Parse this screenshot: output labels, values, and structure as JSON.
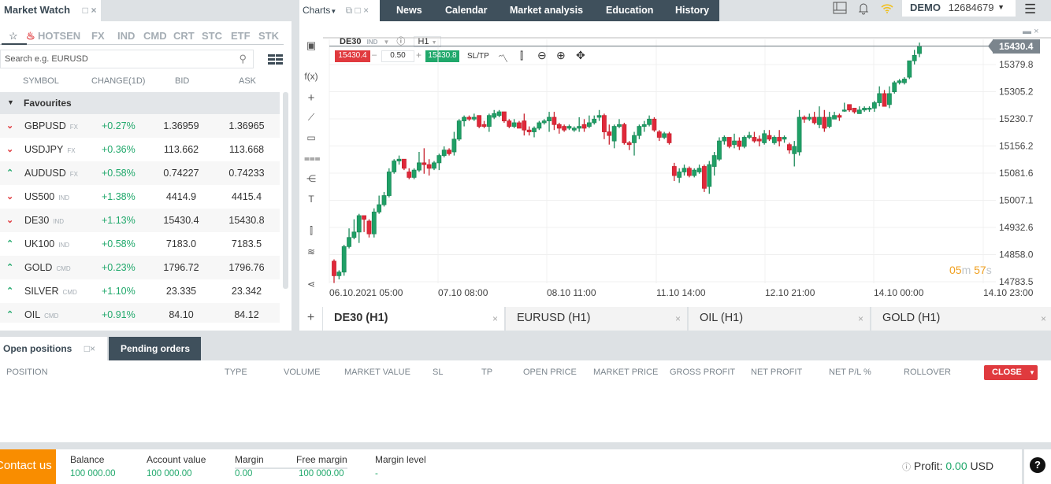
{
  "market_watch": {
    "title": "Market Watch",
    "categories": [
      "HOTSEN",
      "FX",
      "IND",
      "CMD",
      "CRT",
      "STC",
      "ETF",
      "STK"
    ],
    "search_placeholder": "Search e.g. EURUSD",
    "columns": [
      "SYMBOL",
      "CHANGE(1D)",
      "BID",
      "ASK"
    ],
    "group": "Favourites",
    "rows": [
      {
        "dir": "down",
        "symbol": "GBPUSD",
        "type": "FX",
        "change": "+0.27%",
        "bid": "1.36959",
        "ask": "1.36965"
      },
      {
        "dir": "down",
        "symbol": "USDJPY",
        "type": "FX",
        "change": "+0.36%",
        "bid": "113.662",
        "ask": "113.668"
      },
      {
        "dir": "up",
        "symbol": "AUDUSD",
        "type": "FX",
        "change": "+0.58%",
        "bid": "0.74227",
        "ask": "0.74233"
      },
      {
        "dir": "down",
        "symbol": "US500",
        "type": "IND",
        "change": "+1.38%",
        "bid": "4414.9",
        "ask": "4415.4"
      },
      {
        "dir": "down",
        "symbol": "DE30",
        "type": "IND",
        "change": "+1.13%",
        "bid": "15430.4",
        "ask": "15430.8"
      },
      {
        "dir": "up",
        "symbol": "UK100",
        "type": "IND",
        "change": "+0.58%",
        "bid": "7183.0",
        "ask": "7183.5"
      },
      {
        "dir": "up",
        "symbol": "GOLD",
        "type": "CMD",
        "change": "+0.23%",
        "bid": "1796.72",
        "ask": "1796.76"
      },
      {
        "dir": "up",
        "symbol": "SILVER",
        "type": "CMD",
        "change": "+1.10%",
        "bid": "23.335",
        "ask": "23.342"
      },
      {
        "dir": "up",
        "symbol": "OIL",
        "type": "CMD",
        "change": "+0.91%",
        "bid": "84.10",
        "ask": "84.12"
      }
    ]
  },
  "top_nav": {
    "charts_label": "Charts",
    "items": [
      "News",
      "Calendar",
      "Market analysis",
      "Education",
      "History"
    ],
    "account_mode": "DEMO",
    "account_number": "12684679"
  },
  "chart": {
    "symbol": "DE30",
    "symbol_type": "IND",
    "timeframe": "H1",
    "sell_price": "15430.4",
    "volume": "0.50",
    "buy_price": "15430.8",
    "sltp_label": "SL/TP",
    "current_price": "15430.4",
    "timer_min": "05",
    "timer_sec": "57",
    "tabs": [
      {
        "label": "DE30 (H1)",
        "active": true
      },
      {
        "label": "EURUSD (H1)",
        "active": false
      },
      {
        "label": "OIL (H1)",
        "active": false
      },
      {
        "label": "GOLD (H1)",
        "active": false
      }
    ]
  },
  "chart_data": {
    "type": "candlestick",
    "title": "DE30 H1",
    "xlabel": "",
    "ylabel": "",
    "y_ticks": [
      "15379.8",
      "15305.2",
      "15230.7",
      "15156.2",
      "15081.6",
      "15007.1",
      "14932.6",
      "14858.0",
      "14783.5"
    ],
    "ylim": [
      14770,
      15440
    ],
    "x_ticks": [
      "06.10.2021 05:00",
      "07.10 08:00",
      "08.10 11:00",
      "11.10 14:00",
      "12.10 21:00",
      "14.10 00:00",
      "14.10 23:00"
    ],
    "last_price": 15430.4,
    "candles": [
      [
        14840,
        14800,
        14845,
        14780
      ],
      [
        14800,
        14810,
        14815,
        14790
      ],
      [
        14810,
        14880,
        14885,
        14800
      ],
      [
        14880,
        14905,
        14930,
        14875
      ],
      [
        14905,
        14920,
        14955,
        14900
      ],
      [
        14920,
        14965,
        14970,
        14890
      ],
      [
        14965,
        14955,
        14965,
        14920
      ],
      [
        14950,
        14915,
        14955,
        14905
      ],
      [
        14915,
        14975,
        14985,
        14905
      ],
      [
        14975,
        14995,
        15020,
        14970
      ],
      [
        14995,
        15020,
        15030,
        14990
      ],
      [
        15020,
        15085,
        15095,
        15015
      ],
      [
        15085,
        15115,
        15120,
        15080
      ],
      [
        15115,
        15120,
        15130,
        15105
      ],
      [
        15120,
        15095,
        15120,
        15090
      ],
      [
        15085,
        15070,
        15095,
        15065
      ],
      [
        15070,
        15090,
        15095,
        15065
      ],
      [
        15090,
        15110,
        15140,
        15085
      ],
      [
        15110,
        15105,
        15150,
        15080
      ],
      [
        15105,
        15095,
        15120,
        15075
      ],
      [
        15095,
        15110,
        15115,
        15090
      ],
      [
        15110,
        15130,
        15135,
        15090
      ],
      [
        15130,
        15145,
        15155,
        15125
      ],
      [
        15145,
        15135,
        15150,
        15130
      ],
      [
        15140,
        15175,
        15195,
        15130
      ],
      [
        15175,
        15225,
        15230,
        15170
      ],
      [
        15225,
        15235,
        15240,
        15210
      ],
      [
        15235,
        15230,
        15240,
        15225
      ],
      [
        15230,
        15235,
        15245,
        15225
      ],
      [
        15240,
        15210,
        15240,
        15205
      ],
      [
        15215,
        15210,
        15225,
        15205
      ],
      [
        15210,
        15240,
        15245,
        15195
      ],
      [
        15235,
        15245,
        15255,
        15230
      ],
      [
        15240,
        15250,
        15255,
        15235
      ],
      [
        15250,
        15225,
        15250,
        15220
      ],
      [
        15225,
        15210,
        15230,
        15205
      ],
      [
        15210,
        15220,
        15230,
        15205
      ],
      [
        15220,
        15205,
        15225,
        15205
      ],
      [
        15225,
        15200,
        15245,
        15185
      ],
      [
        15200,
        15195,
        15210,
        15185
      ],
      [
        15195,
        15205,
        15210,
        15180
      ],
      [
        15205,
        15220,
        15225,
        15200
      ],
      [
        15220,
        15225,
        15230,
        15215
      ],
      [
        15225,
        15235,
        15250,
        15195
      ],
      [
        15235,
        15215,
        15250,
        15200
      ],
      [
        15215,
        15205,
        15220,
        15190
      ],
      [
        15210,
        15200,
        15215,
        15195
      ],
      [
        15205,
        15210,
        15215,
        15200
      ],
      [
        15200,
        15205,
        15210,
        15195
      ],
      [
        15205,
        15210,
        15235,
        15195
      ],
      [
        15215,
        15205,
        15230,
        15195
      ],
      [
        15210,
        15220,
        15240,
        15205
      ],
      [
        15220,
        15230,
        15240,
        15215
      ],
      [
        15235,
        15240,
        15255,
        15225
      ],
      [
        15240,
        15195,
        15245,
        15175
      ],
      [
        15195,
        15185,
        15215,
        15160
      ],
      [
        15170,
        15210,
        15215,
        15150
      ],
      [
        15210,
        15215,
        15230,
        15205
      ],
      [
        15215,
        15165,
        15220,
        15160
      ],
      [
        15165,
        15160,
        15170,
        15145
      ],
      [
        15165,
        15185,
        15195,
        15130
      ],
      [
        15185,
        15210,
        15215,
        15175
      ],
      [
        15210,
        15215,
        15225,
        15195
      ],
      [
        15215,
        15230,
        15240,
        15210
      ],
      [
        15230,
        15200,
        15235,
        15195
      ],
      [
        15195,
        15180,
        15200,
        15170
      ],
      [
        15180,
        15190,
        15195,
        15175
      ],
      [
        15190,
        15165,
        15195,
        15160
      ],
      [
        15100,
        15075,
        15110,
        15060
      ],
      [
        15070,
        15085,
        15095,
        15055
      ],
      [
        15085,
        15095,
        15105,
        15075
      ],
      [
        15095,
        15075,
        15100,
        15070
      ],
      [
        15075,
        15090,
        15095,
        15070
      ],
      [
        15085,
        15095,
        15105,
        15080
      ],
      [
        15100,
        15040,
        15105,
        15030
      ],
      [
        15045,
        15105,
        15115,
        15025
      ],
      [
        15100,
        15130,
        15140,
        15075
      ],
      [
        15120,
        15170,
        15180,
        15115
      ],
      [
        15170,
        15180,
        15185,
        15160
      ],
      [
        15180,
        15155,
        15180,
        15150
      ],
      [
        15160,
        15170,
        15190,
        15150
      ],
      [
        15170,
        15155,
        15180,
        15145
      ],
      [
        15155,
        15180,
        15185,
        15150
      ],
      [
        15180,
        15185,
        15195,
        15175
      ],
      [
        15180,
        15170,
        15195,
        15165
      ],
      [
        15175,
        15170,
        15185,
        15155
      ],
      [
        15165,
        15190,
        15200,
        15160
      ],
      [
        15185,
        15175,
        15200,
        15170
      ],
      [
        15165,
        15180,
        15185,
        15160
      ],
      [
        15180,
        15170,
        15200,
        15155
      ],
      [
        15175,
        15180,
        15185,
        15165
      ],
      [
        15160,
        15145,
        15165,
        15135
      ],
      [
        15135,
        15155,
        15170,
        15100
      ],
      [
        15140,
        15235,
        15255,
        15130
      ],
      [
        15235,
        15230,
        15240,
        15220
      ],
      [
        15230,
        15235,
        15245,
        15225
      ],
      [
        15235,
        15220,
        15250,
        15215
      ],
      [
        15215,
        15235,
        15265,
        15205
      ],
      [
        15235,
        15205,
        15255,
        15195
      ],
      [
        15210,
        15235,
        15250,
        15205
      ],
      [
        15230,
        15240,
        15250,
        15230
      ],
      [
        15240,
        15235,
        15245,
        15225
      ],
      [
        15255,
        15255,
        15275,
        15250
      ],
      [
        15270,
        15255,
        15270,
        15250
      ],
      [
        15260,
        15250,
        15260,
        15245
      ],
      [
        15245,
        15255,
        15265,
        15245
      ],
      [
        15255,
        15260,
        15265,
        15250
      ],
      [
        15260,
        15260,
        15265,
        15250
      ],
      [
        15260,
        15275,
        15280,
        15250
      ],
      [
        15275,
        15300,
        15320,
        15265
      ],
      [
        15300,
        15265,
        15310,
        15265
      ],
      [
        15270,
        15300,
        15320,
        15260
      ],
      [
        15305,
        15330,
        15335,
        15300
      ],
      [
        15330,
        15335,
        15340,
        15325
      ],
      [
        15330,
        15340,
        15345,
        15325
      ],
      [
        15345,
        15390,
        15390,
        15340
      ],
      [
        15390,
        15405,
        15420,
        15380
      ],
      [
        15410,
        15430,
        15440,
        15400
      ]
    ]
  },
  "positions": {
    "tab_open": "Open positions",
    "tab_pending": "Pending orders",
    "columns": [
      "POSITION",
      "TYPE",
      "VOLUME",
      "MARKET VALUE",
      "SL",
      "TP",
      "OPEN PRICE",
      "MARKET PRICE",
      "GROSS PROFIT",
      "NET PROFIT",
      "NET P/L %",
      "ROLLOVER"
    ],
    "close_label": "CLOSE"
  },
  "footer": {
    "contact": "Contact us",
    "balance_label": "Balance",
    "balance": "100 000.00",
    "account_value_label": "Account value",
    "account_value": "100 000.00",
    "margin_label": "Margin",
    "margin": "0.00",
    "free_margin_label": "Free margin",
    "free_margin": "100 000.00",
    "margin_level_label": "Margin level",
    "margin_level": "-",
    "profit_label": "Profit:",
    "profit": "0.00",
    "currency": "USD"
  },
  "colors": {
    "up": "#20a86b",
    "down": "#e03a3e",
    "nav": "#3f505c",
    "contact": "#f98d00",
    "timer": "#f0a020"
  }
}
